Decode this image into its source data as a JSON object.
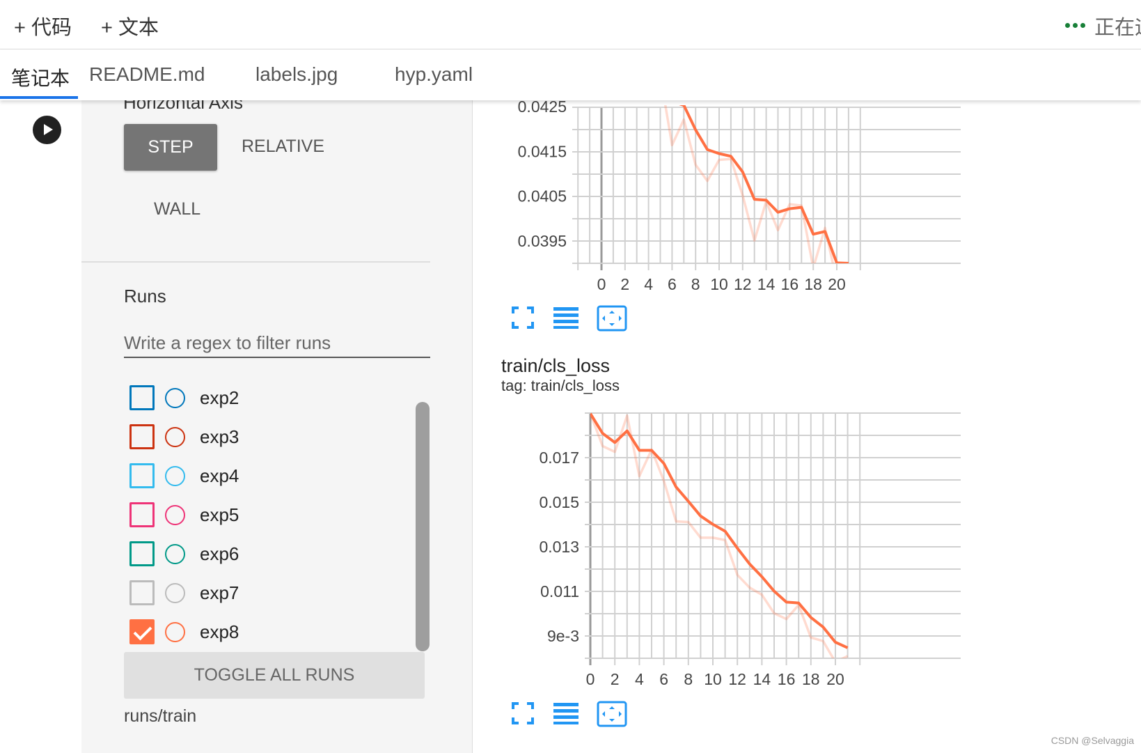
{
  "toolbar": {
    "add_code": "+ 代码",
    "add_text": "+ 文本",
    "status": "正在运",
    "status_color": "#188038"
  },
  "tabs": [
    {
      "label": "笔记本",
      "active": true
    },
    {
      "label": "README.md"
    },
    {
      "label": "labels.jpg"
    },
    {
      "label": "hyp.yaml"
    }
  ],
  "sidebar": {
    "horizontal_axis_title": "Horizontal Axis",
    "axis_options": [
      "STEP",
      "RELATIVE",
      "WALL"
    ],
    "selected_axis": "STEP",
    "runs_title": "Runs",
    "filter_placeholder": "Write a regex to filter runs",
    "runs": [
      {
        "name": "exp2",
        "color": "#0077bb",
        "checked": false
      },
      {
        "name": "exp3",
        "color": "#cc3311",
        "checked": false
      },
      {
        "name": "exp4",
        "color": "#33bbee",
        "checked": false
      },
      {
        "name": "exp5",
        "color": "#ee3377",
        "checked": false
      },
      {
        "name": "exp6",
        "color": "#009988",
        "checked": false
      },
      {
        "name": "exp7",
        "color": "#bbbbbb",
        "checked": false
      },
      {
        "name": "exp8",
        "color": "#ff7043",
        "checked": true
      }
    ],
    "toggle_all": "TOGGLE ALL RUNS",
    "runs_dir": "runs/train"
  },
  "chart_data": [
    {
      "type": "line",
      "title": "",
      "ylim": [
        0.039,
        0.0425
      ],
      "xlim": [
        -2,
        22
      ],
      "yticks": [
        "0.0425",
        "0.0415",
        "0.0405",
        "0.0395"
      ],
      "xticks": [
        "0",
        "2",
        "4",
        "6",
        "8",
        "10",
        "12",
        "14",
        "16",
        "18",
        "20"
      ],
      "grid": true,
      "color": "#ff7043",
      "series": [
        {
          "smoothed": true,
          "x": [
            5,
            6,
            7,
            8,
            9,
            10,
            11,
            12,
            13,
            14,
            15,
            16,
            17,
            18,
            19,
            20,
            21
          ],
          "y": [
            0.0428,
            0.04261,
            0.04253,
            0.04198,
            0.04154,
            0.04145,
            0.04139,
            0.04104,
            0.04043,
            0.04041,
            0.04014,
            0.04022,
            0.04025,
            0.03965,
            0.03971,
            0.03901,
            0.039
          ]
        },
        {
          "smoothed": false,
          "x": [
            5,
            6,
            7,
            8,
            9,
            10,
            11,
            12,
            13,
            14,
            15,
            16,
            17,
            18,
            19,
            20
          ],
          "y": [
            0.0432,
            0.04164,
            0.04221,
            0.0412,
            0.04084,
            0.04131,
            0.04133,
            0.04052,
            0.03951,
            0.04038,
            0.03974,
            0.04032,
            0.04029,
            0.0389,
            0.03979,
            0.0386
          ]
        }
      ]
    },
    {
      "type": "line",
      "title": "train/cls_loss",
      "tag": "tag: train/cls_loss",
      "ylim": [
        0.008,
        0.019
      ],
      "xlim": [
        -2,
        22
      ],
      "yticks": [
        "0.017",
        "0.015",
        "0.013",
        "0.011",
        "9e-3"
      ],
      "xticks": [
        "0",
        "2",
        "4",
        "6",
        "8",
        "10",
        "12",
        "14",
        "16",
        "18",
        "20"
      ],
      "grid": true,
      "color": "#ff7043",
      "series": [
        {
          "smoothed": true,
          "x": [
            0,
            1,
            2,
            3,
            4,
            5,
            6,
            7,
            8,
            9,
            10,
            11,
            12,
            13,
            14,
            15,
            16,
            17,
            18,
            19,
            20,
            21
          ],
          "y": [
            0.01898,
            0.01809,
            0.01768,
            0.0182,
            0.01733,
            0.01733,
            0.01674,
            0.01568,
            0.01504,
            0.01438,
            0.01401,
            0.0137,
            0.01294,
            0.01223,
            0.01166,
            0.01101,
            0.01052,
            0.01048,
            0.00983,
            0.0094,
            0.00872,
            0.00847
          ]
        },
        {
          "smoothed": false,
          "x": [
            0,
            1,
            2,
            3,
            4,
            5,
            6,
            7,
            8,
            9,
            10,
            11,
            12,
            13,
            14,
            15,
            16,
            17,
            18,
            19,
            20,
            21
          ],
          "y": [
            0.01898,
            0.01752,
            0.01726,
            0.01888,
            0.01617,
            0.01736,
            0.01596,
            0.01414,
            0.01411,
            0.01341,
            0.01341,
            0.0133,
            0.01174,
            0.01117,
            0.01085,
            0.01002,
            0.00976,
            0.01039,
            0.00893,
            0.00877,
            0.00783,
            0.0081
          ]
        }
      ]
    }
  ],
  "watermark": "CSDN @Selvaggia"
}
